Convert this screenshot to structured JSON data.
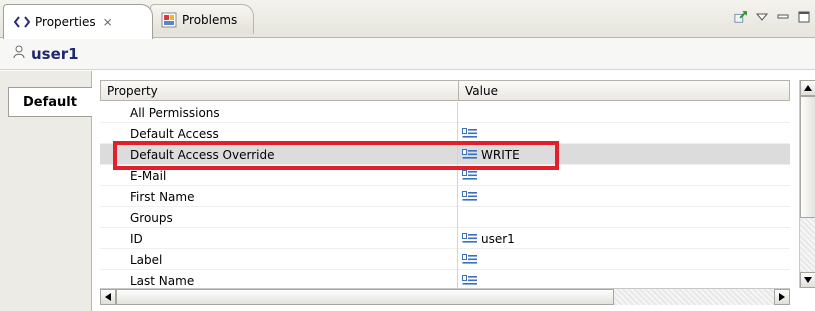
{
  "tabs": [
    {
      "label": "Properties",
      "icon": "properties-icon",
      "active": true,
      "closable": true
    },
    {
      "label": "Problems",
      "icon": "problems-icon",
      "active": false
    }
  ],
  "view_controls": [
    "pin-editor-icon",
    "view-menu-icon",
    "minimize-icon",
    "maximize-icon"
  ],
  "title": {
    "icon": "user-icon",
    "text": "user1"
  },
  "side_tabs": [
    {
      "label": "Default",
      "active": true
    }
  ],
  "table": {
    "headers": {
      "property": "Property",
      "value": "Value"
    },
    "rows": [
      {
        "property": "All Permissions",
        "value": "",
        "has_icon": false
      },
      {
        "property": "Default Access",
        "value": "",
        "has_icon": true
      },
      {
        "property": "Default Access Override",
        "value": "WRITE",
        "has_icon": true,
        "selected": true
      },
      {
        "property": "E-Mail",
        "value": "",
        "has_icon": true
      },
      {
        "property": "First Name",
        "value": "",
        "has_icon": true
      },
      {
        "property": "Groups",
        "value": "",
        "has_icon": false
      },
      {
        "property": "ID",
        "value": "user1",
        "has_icon": true
      },
      {
        "property": "Label",
        "value": "",
        "has_icon": true
      },
      {
        "property": "Last Name",
        "value": "",
        "has_icon": true
      }
    ]
  },
  "colors": {
    "highlight": "#e0202a",
    "title_text": "#1f2a6b",
    "selected_row": "#dcdcdc"
  }
}
